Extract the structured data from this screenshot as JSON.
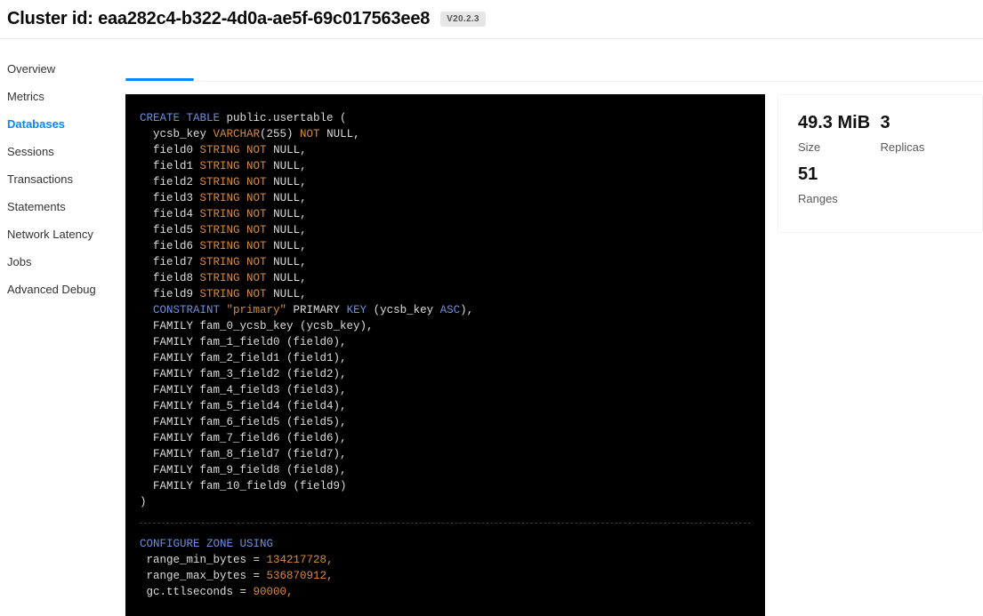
{
  "header": {
    "title_prefix": "Cluster id:",
    "cluster_id": "eaa282c4-b322-4d0a-ae5f-69c017563ee8",
    "version": "V20.2.3"
  },
  "sidebar": {
    "items": [
      {
        "label": "Overview"
      },
      {
        "label": "Metrics"
      },
      {
        "label": "Databases"
      },
      {
        "label": "Sessions"
      },
      {
        "label": "Transactions"
      },
      {
        "label": "Statements"
      },
      {
        "label": "Network Latency"
      },
      {
        "label": "Jobs"
      },
      {
        "label": "Advanced Debug"
      }
    ],
    "active_index": 2
  },
  "sql": {
    "create_table": {
      "line1_a": "CREATE TABLE",
      "line1_b": " public.usertable (",
      "col_key_pre": "  ycsb_key ",
      "col_key_type": "VARCHAR",
      "col_key_mid": "(255) ",
      "not": "NOT",
      "null_suffix": " NULL,",
      "fields": [
        {
          "pre": "  field0 ",
          "type": "STRING"
        },
        {
          "pre": "  field1 ",
          "type": "STRING"
        },
        {
          "pre": "  field2 ",
          "type": "STRING"
        },
        {
          "pre": "  field3 ",
          "type": "STRING"
        },
        {
          "pre": "  field4 ",
          "type": "STRING"
        },
        {
          "pre": "  field5 ",
          "type": "STRING"
        },
        {
          "pre": "  field6 ",
          "type": "STRING"
        },
        {
          "pre": "  field7 ",
          "type": "STRING"
        },
        {
          "pre": "  field8 ",
          "type": "STRING"
        },
        {
          "pre": "  field9 ",
          "type": "STRING"
        }
      ],
      "constraint_kw": "  CONSTRAINT ",
      "constraint_name": "\"primary\"",
      "constraint_mid": " PRIMARY ",
      "key_kw": "KEY",
      "constraint_open": " (ycsb_key ",
      "asc_kw": "ASC",
      "constraint_close": "),",
      "families": [
        "  FAMILY fam_0_ycsb_key (ycsb_key),",
        "  FAMILY fam_1_field0 (field0),",
        "  FAMILY fam_2_field1 (field1),",
        "  FAMILY fam_3_field2 (field2),",
        "  FAMILY fam_4_field3 (field3),",
        "  FAMILY fam_5_field4 (field4),",
        "  FAMILY fam_6_field5 (field5),",
        "  FAMILY fam_7_field6 (field6),",
        "  FAMILY fam_8_field7 (field7),",
        "  FAMILY fam_9_field8 (field8),",
        "  FAMILY fam_10_field9 (field9)"
      ],
      "close": ")"
    },
    "configure": {
      "header": "CONFIGURE ZONE USING",
      "rows": [
        {
          "left": " range_min_bytes = ",
          "right": "134217728,"
        },
        {
          "left": " range_max_bytes = ",
          "right": "536870912,"
        },
        {
          "left": " gc.ttlseconds = ",
          "right": "90000,"
        }
      ]
    }
  },
  "stats": {
    "size_value": "49.3 MiB",
    "size_label": "Size",
    "replicas_value": "3",
    "replicas_label": "Replicas",
    "ranges_value": "51",
    "ranges_label": "Ranges"
  }
}
